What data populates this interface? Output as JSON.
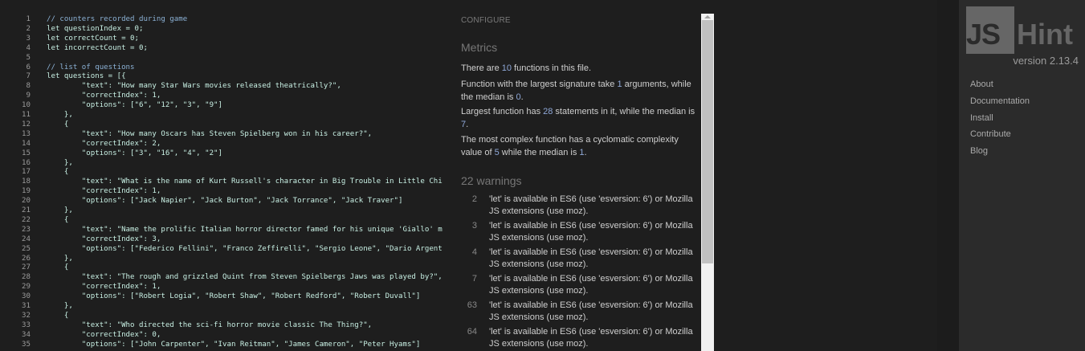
{
  "editor": {
    "lines": [
      {
        "n": "1",
        "t": "// counters recorded during game",
        "c": true
      },
      {
        "n": "2",
        "t": "let questionIndex = 0;"
      },
      {
        "n": "3",
        "t": "let correctCount = 0;"
      },
      {
        "n": "4",
        "t": "let incorrectCount = 0;"
      },
      {
        "n": "5",
        "t": ""
      },
      {
        "n": "6",
        "t": "// list of questions",
        "c": true
      },
      {
        "n": "7",
        "t": "let questions = [{"
      },
      {
        "n": "8",
        "t": "        \"text\": \"How many Star Wars movies released theatrically?\","
      },
      {
        "n": "9",
        "t": "        \"correctIndex\": 1,"
      },
      {
        "n": "10",
        "t": "        \"options\": [\"6\", \"12\", \"3\", \"9\"]"
      },
      {
        "n": "11",
        "t": "    },"
      },
      {
        "n": "12",
        "t": "    {"
      },
      {
        "n": "13",
        "t": "        \"text\": \"How many Oscars has Steven Spielberg won in his career?\","
      },
      {
        "n": "14",
        "t": "        \"correctIndex\": 2,"
      },
      {
        "n": "15",
        "t": "        \"options\": [\"3\", \"16\", \"4\", \"2\"]"
      },
      {
        "n": "16",
        "t": "    },"
      },
      {
        "n": "17",
        "t": "    {"
      },
      {
        "n": "18",
        "t": "        \"text\": \"What is the name of Kurt Russell's character in Big Trouble in Little Chi"
      },
      {
        "n": "19",
        "t": "        \"correctIndex\": 1,"
      },
      {
        "n": "20",
        "t": "        \"options\": [\"Jack Napier\", \"Jack Burton\", \"Jack Torrance\", \"Jack Traver\"]"
      },
      {
        "n": "21",
        "t": "    },"
      },
      {
        "n": "22",
        "t": "    {"
      },
      {
        "n": "23",
        "t": "        \"text\": \"Name the prolific Italian horror director famed for his unique 'Giallo' m"
      },
      {
        "n": "24",
        "t": "        \"correctIndex\": 3,"
      },
      {
        "n": "25",
        "t": "        \"options\": [\"Federico Fellini\", \"Franco Zeffirelli\", \"Sergio Leone\", \"Dario Argent"
      },
      {
        "n": "26",
        "t": "    },"
      },
      {
        "n": "27",
        "t": "    {"
      },
      {
        "n": "28",
        "t": "        \"text\": \"The rough and grizzled Quint from Steven Spielbergs Jaws was played by?\","
      },
      {
        "n": "29",
        "t": "        \"correctIndex\": 1,"
      },
      {
        "n": "30",
        "t": "        \"options\": [\"Robert Logia\", \"Robert Shaw\", \"Robert Redford\", \"Robert Duvall\"]"
      },
      {
        "n": "31",
        "t": "    },"
      },
      {
        "n": "32",
        "t": "    {"
      },
      {
        "n": "33",
        "t": "        \"text\": \"Who directed the sci-fi horror movie classic The Thing?\","
      },
      {
        "n": "34",
        "t": "        \"correctIndex\": 0,"
      },
      {
        "n": "35",
        "t": "        \"options\": [\"John Carpenter\", \"Ivan Reitman\", \"James Cameron\", \"Peter Hyams\"]"
      }
    ]
  },
  "panel": {
    "configure": "CONFIGURE",
    "metrics_title": "Metrics",
    "metrics": [
      [
        "There are ",
        "10",
        " functions in this file."
      ],
      [
        "Function with the largest signature take ",
        "1",
        " arguments, while the median is ",
        "0",
        "."
      ],
      [
        "Largest function has ",
        "28",
        " statements in it, while the median is ",
        "7",
        "."
      ],
      [
        "The most complex function has a cyclomatic complexity value of ",
        "5",
        " while the median is ",
        "1",
        "."
      ]
    ],
    "warnings_title": "22 warnings",
    "warnings": [
      {
        "line": "2",
        "text": "'let' is available in ES6 (use 'esversion: 6') or Mozilla JS extensions (use moz)."
      },
      {
        "line": "3",
        "text": "'let' is available in ES6 (use 'esversion: 6') or Mozilla JS extensions (use moz)."
      },
      {
        "line": "4",
        "text": "'let' is available in ES6 (use 'esversion: 6') or Mozilla JS extensions (use moz)."
      },
      {
        "line": "7",
        "text": "'let' is available in ES6 (use 'esversion: 6') or Mozilla JS extensions (use moz)."
      },
      {
        "line": "63",
        "text": "'let' is available in ES6 (use 'esversion: 6') or Mozilla JS extensions (use moz)."
      },
      {
        "line": "64",
        "text": "'let' is available in ES6 (use 'esversion: 6') or Mozilla JS extensions (use moz)."
      }
    ]
  },
  "sidebar": {
    "logo_js": "JS",
    "logo_hint": "Hint",
    "version": "version 2.13.4",
    "nav": [
      "About",
      "Documentation",
      "Install",
      "Contribute",
      "Blog"
    ]
  }
}
